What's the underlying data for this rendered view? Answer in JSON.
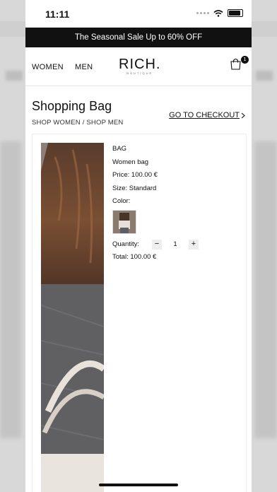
{
  "status_bar": {
    "time": "11:11"
  },
  "promo_banner": {
    "text": "The Seasonal Sale Up to 60% OFF"
  },
  "nav": {
    "women_label": "WOMEN",
    "men_label": "MEN",
    "logo_main": "RICH.",
    "logo_sub": "BOUTIQUE",
    "cart_count": "1"
  },
  "page": {
    "title": "Shopping Bag",
    "breadcrumb_women": "SHOP WOMEN",
    "breadcrumb_sep": "/",
    "breadcrumb_men": "SHOP MEN",
    "checkout_label": "GO TO CHECKOUT"
  },
  "item": {
    "name": "BAG",
    "description": "Women bag",
    "price": "Price: 100.00 €",
    "size": "Size: Standard",
    "color_label": "Color:",
    "quantity_label": "Quantity:",
    "minus": "−",
    "quantity": "1",
    "plus": "+",
    "total": "Total: 100.00 €"
  },
  "colors": {
    "promo_bg": "#111111",
    "accent": "#111111"
  }
}
